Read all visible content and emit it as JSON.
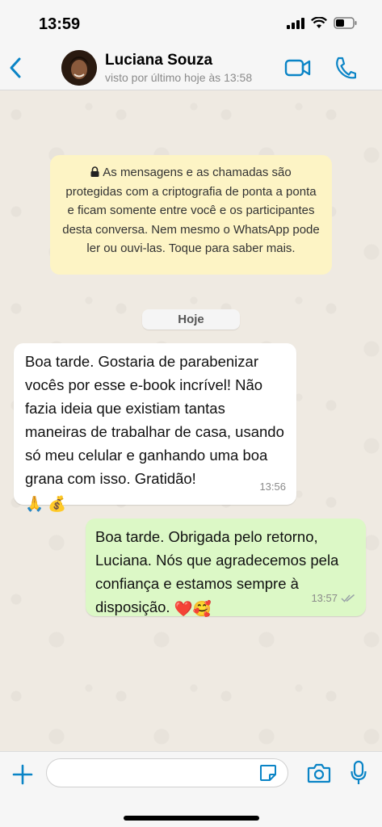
{
  "status_bar": {
    "time": "13:59"
  },
  "header": {
    "contact_name": "Luciana Souza",
    "contact_status": "visto por último hoje às 13:58"
  },
  "chat": {
    "encryption_notice": "As mensagens e as chamadas são protegidas com a criptografia de ponta a ponta e ficam somente entre você e os participantes desta conversa. Nem mesmo o WhatsApp pode ler ou ouvi-las. Toque para saber mais.",
    "date_label": "Hoje",
    "messages": [
      {
        "direction": "incoming",
        "text": "Boa tarde. Gostaria de parabenizar vocês por esse e-book incrível! Não fazia ideia que existiam tantas maneiras de trabalhar de casa, usando só meu celular e ganhando uma boa grana com isso. Gratidão!",
        "emojis": "🙏 💰",
        "time": "13:56"
      },
      {
        "direction": "outgoing",
        "text": "Boa tarde. Obrigada pelo retorno, Luciana. Nós que agradecemos pela confiança e estamos sempre à disposição.",
        "emojis": "❤️🥰",
        "time": "13:57",
        "status": "read"
      }
    ]
  },
  "input_bar": {
    "placeholder": ""
  },
  "colors": {
    "accent": "#0a84c6",
    "outgoing_bubble": "#dcf8c6",
    "incoming_bubble": "#ffffff",
    "notice_bg": "#fdf4c5",
    "chat_bg": "#efeae2"
  }
}
